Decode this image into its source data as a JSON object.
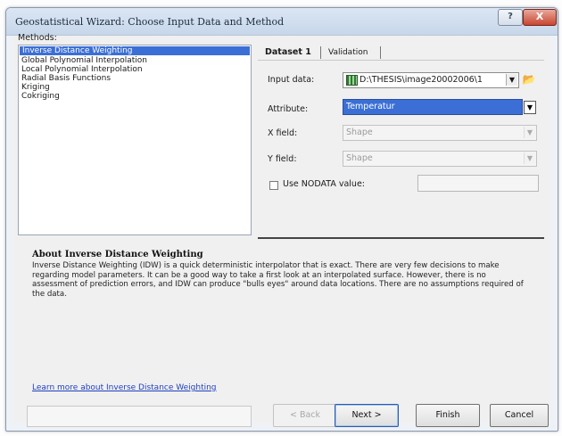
{
  "window": {
    "title": "Geostatistical Wizard: Choose Input Data and Method",
    "help_label": "?",
    "close_label": "X"
  },
  "methods": {
    "label": "Methods:",
    "items": [
      "Inverse Distance Weighting",
      "Global Polynomial Interpolation",
      "Local Polynomial Interpolation",
      "Radial Basis Functions",
      "Kriging",
      "Cokriging"
    ],
    "selected_index": 0
  },
  "tabs": [
    {
      "label": "Dataset 1"
    },
    {
      "label": "Validation"
    }
  ],
  "dataset": {
    "input_data_label": "Input data:",
    "input_data_value": "D:\\THESIS\\image20002006\\1",
    "attribute_label": "Attribute:",
    "attribute_value": "Temperatur",
    "x_field_label": "X field:",
    "x_field_value": "Shape",
    "y_field_label": "Y field:",
    "y_field_value": "Shape",
    "nodata_label": "Use NODATA value:",
    "nodata_checked": false
  },
  "about": {
    "title": "About Inverse Distance Weighting",
    "text": "Inverse Distance Weighting (IDW) is a quick deterministic interpolator that is exact. There are very few decisions to make regarding model parameters. It can be a good way to take a first look at an interpolated surface. However, there is no assessment of prediction errors, and IDW can produce \"bulls eyes\" around data locations. There are no assumptions required of the data.",
    "learn_more_link": "Learn more about Inverse Distance Weighting"
  },
  "buttons": {
    "back": "< Back",
    "next": "Next >",
    "finish": "Finish",
    "cancel": "Cancel"
  },
  "icons": {
    "folder": "open-folder-icon",
    "raster": "raster-layer-icon",
    "dropdown": "chevron-down-icon"
  },
  "colors": {
    "selection": "#3b6fd6",
    "link": "#1f3fbf",
    "close_button": "#c8452f"
  }
}
